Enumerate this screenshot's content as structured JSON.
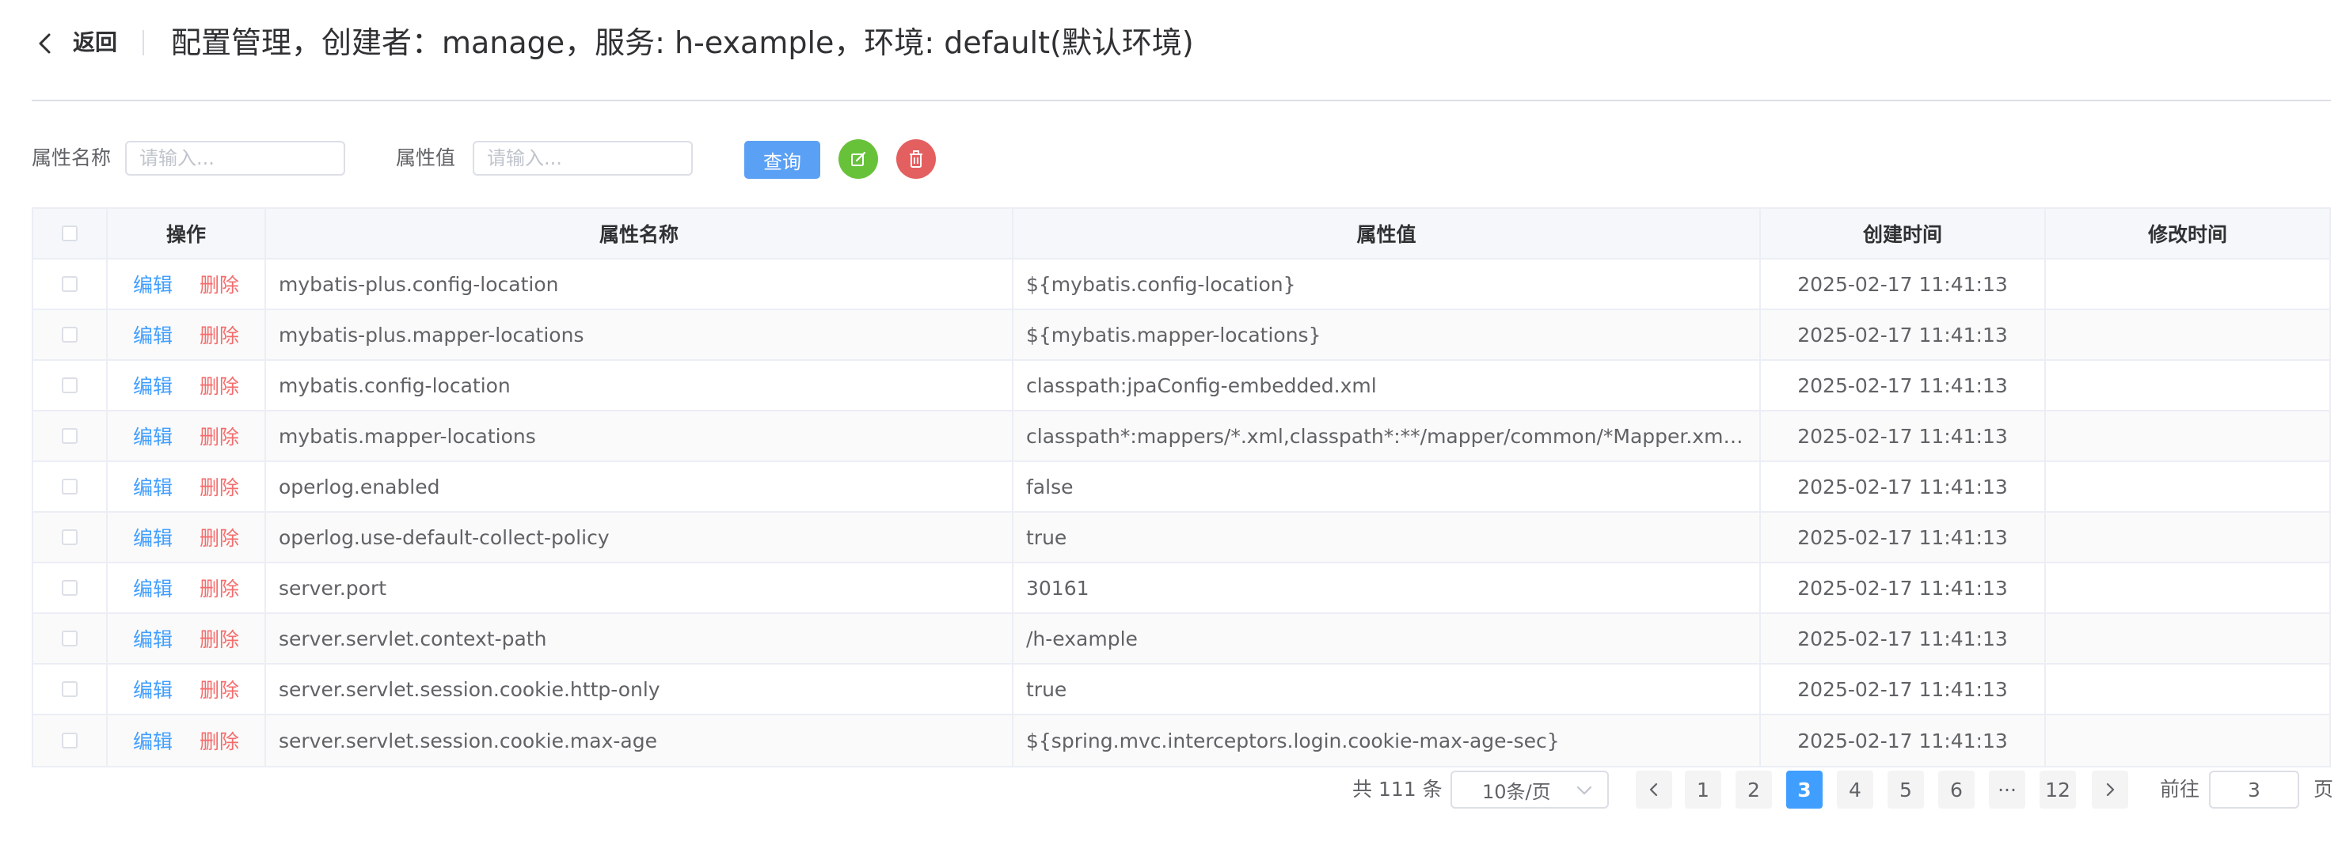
{
  "header": {
    "back_label": "返回",
    "title": "配置管理，创建者：manage，服务: h-example，环境: default(默认环境)"
  },
  "filters": {
    "name_label": "属性名称",
    "name_placeholder": "请输入...",
    "value_label": "属性值",
    "value_placeholder": "请输入...",
    "query_label": "查询",
    "add_icon": "edit-square-icon",
    "delete_icon": "trash-icon",
    "colors": {
      "query": "#5aa0f5",
      "add": "#67c23a",
      "delete": "#e45f5f"
    }
  },
  "table": {
    "columns": [
      "操作",
      "属性名称",
      "属性值",
      "创建时间",
      "修改时间"
    ],
    "edit_label": "编辑",
    "delete_label": "删除",
    "rows": [
      {
        "name": "mybatis-plus.config-location",
        "value": "${mybatis.config-location}",
        "created": "2025-02-17 11:41:13",
        "modified": ""
      },
      {
        "name": "mybatis-plus.mapper-locations",
        "value": "${mybatis.mapper-locations}",
        "created": "2025-02-17 11:41:13",
        "modified": ""
      },
      {
        "name": "mybatis.config-location",
        "value": "classpath:jpaConfig-embedded.xml",
        "created": "2025-02-17 11:41:13",
        "modified": ""
      },
      {
        "name": "mybatis.mapper-locations",
        "value": "classpath*:mappers/*.xml,classpath*:**/mapper/common/*Mapper.xml,classp...",
        "created": "2025-02-17 11:41:13",
        "modified": ""
      },
      {
        "name": "operlog.enabled",
        "value": "false",
        "created": "2025-02-17 11:41:13",
        "modified": ""
      },
      {
        "name": "operlog.use-default-collect-policy",
        "value": "true",
        "created": "2025-02-17 11:41:13",
        "modified": ""
      },
      {
        "name": "server.port",
        "value": "30161",
        "created": "2025-02-17 11:41:13",
        "modified": ""
      },
      {
        "name": "server.servlet.context-path",
        "value": "/h-example",
        "created": "2025-02-17 11:41:13",
        "modified": ""
      },
      {
        "name": "server.servlet.session.cookie.http-only",
        "value": "true",
        "created": "2025-02-17 11:41:13",
        "modified": ""
      },
      {
        "name": "server.servlet.session.cookie.max-age",
        "value": "${spring.mvc.interceptors.login.cookie-max-age-sec}",
        "created": "2025-02-17 11:41:13",
        "modified": ""
      }
    ]
  },
  "pagination": {
    "total_text": "共 111 条",
    "page_size": "10条/页",
    "pages": [
      "1",
      "2",
      "3",
      "4",
      "5",
      "6",
      "···",
      "12"
    ],
    "current_page": "3",
    "goto_label": "前往",
    "goto_value": "3",
    "page_suffix": "页",
    "active_color": "#409eff"
  }
}
